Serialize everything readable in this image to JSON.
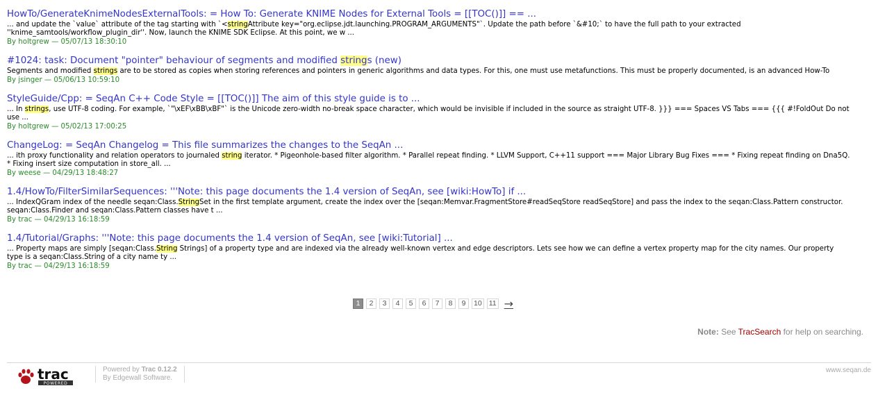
{
  "results": [
    {
      "title": "HowTo/GenerateKnimeNodesExternalTools: = How To: Generate KNIME Nodes for External Tools = [[TOC()]] == ...",
      "title_parts": [
        {
          "text": "HowTo/GenerateKnimeNodesExternalTools: = How To: Generate KNIME Nodes for External Tools = [[TOC()]] == ...",
          "hl": false
        }
      ],
      "excerpt_parts": [
        {
          "text": "... and update the `value` attribute of the tag starting with `<",
          "hl": false
        },
        {
          "text": "string",
          "hl": true
        },
        {
          "text": "Attribute key=\"org.eclipse.jdt.launching.PROGRAM_ARGUMENTS\"`. Update the path before `&#10;` to have the full path to your extracted ''knime_samtools/workflow_plugin_dir''. Now, launch the KNIME SDK Eclipse. At this point, we w ...",
          "hl": false
        }
      ],
      "author": "holtgrew",
      "date": "05/07/13 18:30:10"
    },
    {
      "title": "#1024: task: Document \"pointer\" behaviour of segments and modified strings (new)",
      "title_parts": [
        {
          "text": "#1024: task: Document \"pointer\" behaviour of segments and modified ",
          "hl": false
        },
        {
          "text": "string",
          "hl": true
        },
        {
          "text": "s (new)",
          "hl": false
        }
      ],
      "excerpt_parts": [
        {
          "text": "Segments and modified ",
          "hl": false
        },
        {
          "text": "strings",
          "hl": true
        },
        {
          "text": " are to be stored as copies when storing references and pointers in generic algorithms and data types. For this, one must use metafunctions. This must be properly documented, is an advanced How-To",
          "hl": false
        }
      ],
      "author": "jsinger",
      "date": "05/06/13 10:59:10"
    },
    {
      "title": "StyleGuide/Cpp: = SeqAn C++ Code Style = [[TOC()]] The aim of this style guide is to ...",
      "title_parts": [
        {
          "text": "StyleGuide/Cpp: = SeqAn C++ Code Style = [[TOC()]] The aim of this style guide is to ...",
          "hl": false
        }
      ],
      "excerpt_parts": [
        {
          "text": "... In ",
          "hl": false
        },
        {
          "text": "strings",
          "hl": true
        },
        {
          "text": ", use UTF-8 coding. For example, `\"\\xEF\\xBB\\xBF\"` is the Unicode zero-width no-break space character, which would be invisible if included in the source as straight UTF-8. }}} === Spaces VS Tabs === {{{ #!FoldOut Do not use ...",
          "hl": false
        }
      ],
      "author": "holtgrew",
      "date": "05/02/13 17:00:25"
    },
    {
      "title": "ChangeLog: = SeqAn Changelog = This file summarizes the changes to the SeqAn ...",
      "title_parts": [
        {
          "text": "ChangeLog: = SeqAn Changelog = This file summarizes the changes to the SeqAn ...",
          "hl": false
        }
      ],
      "excerpt_parts": [
        {
          "text": "... ith proxy functionality and relation operators to journaled ",
          "hl": false
        },
        {
          "text": "string",
          "hl": true
        },
        {
          "text": " iterator. * Pigeonhole-based filter algorithm. * Parallel repeat finding. * LLVM Support, C++11 support === Major Library Bug Fixes === * Fixing repeat finding on Dna5Q. * Fixing insert size computation in store_all. ...",
          "hl": false
        }
      ],
      "author": "weese",
      "date": "04/29/13 18:48:27"
    },
    {
      "title": "1.4/HowTo/FilterSimilarSequences: '''Note: this page documents the 1.4 version of SeqAn, see [wiki:HowTo] if ...",
      "title_parts": [
        {
          "text": "1.4/HowTo/FilterSimilarSequences: '''Note: this page documents the 1.4 version of SeqAn, see [wiki:HowTo] if ...",
          "hl": false
        }
      ],
      "excerpt_parts": [
        {
          "text": "... IndexQGram index of the needle seqan:Class.",
          "hl": false
        },
        {
          "text": "String",
          "hl": true
        },
        {
          "text": "Set in the first template argument, create the index over the [seqan:Memvar.FragmentStore#readSeqStore readSeqStore] and pass the index to the seqan:Class.Pattern constructor. seqan:Class.Finder and seqan:Class.Pattern classes have t ...",
          "hl": false
        }
      ],
      "author": "trac",
      "date": "04/29/13 16:18:59"
    },
    {
      "title": "1.4/Tutorial/Graphs: '''Note: this page documents the 1.4 version of SeqAn, see [wiki:Tutorial] ...",
      "title_parts": [
        {
          "text": "1.4/Tutorial/Graphs: '''Note: this page documents the 1.4 version of SeqAn, see [wiki:Tutorial] ...",
          "hl": false
        }
      ],
      "excerpt_parts": [
        {
          "text": "... Property maps are simply [seqan:Class.",
          "hl": false
        },
        {
          "text": "String",
          "hl": true
        },
        {
          "text": " Strings] of a property type and are indexed via the already well-known vertex and edge descriptors. Lets see how we can define a vertex property map for the city names. Our property type is a seqan:Class.String of a city name ty ...",
          "hl": false
        }
      ],
      "author": "trac",
      "date": "04/29/13 16:18:59"
    }
  ],
  "meta_by": "By",
  "meta_sep": "—",
  "pager": {
    "pages": [
      "1",
      "2",
      "3",
      "4",
      "5",
      "6",
      "7",
      "8",
      "9",
      "10",
      "11"
    ],
    "current": "1",
    "next_label": "→"
  },
  "note": {
    "label": "Note:",
    "prefix": "See",
    "link": "TracSearch",
    "suffix": "for help on searching."
  },
  "footer": {
    "logo_text": "trac",
    "logo_sub": "POWERED",
    "powered_prefix": "Powered by",
    "powered_name": "Trac 0.12.2",
    "by_prefix": "By",
    "by_name": "Edgewall Software.",
    "site": "www.seqan.de"
  },
  "colors": {
    "link": "#3535c8",
    "meta": "#2b8a2b",
    "highlight": "#ffff88",
    "note_link": "#a00000",
    "logo": "#b3131b"
  }
}
